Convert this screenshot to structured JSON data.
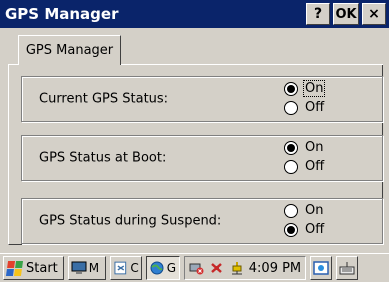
{
  "window": {
    "title": "GPS Manager",
    "help_label": "?",
    "ok_label": "OK",
    "close_label": "×"
  },
  "tab": {
    "label": "GPS Manager"
  },
  "groups": [
    {
      "label": "Current GPS Status:",
      "on_label": "On",
      "off_label": "Off",
      "selected": "On"
    },
    {
      "label": "GPS Status at Boot:",
      "on_label": "On",
      "off_label": "Off",
      "selected": "On"
    },
    {
      "label": "GPS Status during Suspend:",
      "on_label": "On",
      "off_label": "Off",
      "selected": "Off"
    }
  ],
  "taskbar": {
    "start_label": "Start",
    "tasks": [
      {
        "label": "M",
        "icon": "monitor-icon"
      },
      {
        "label": "C",
        "icon": "document-icon"
      },
      {
        "label": "G",
        "icon": "globe-icon"
      }
    ],
    "tray": {
      "time": "4:09 PM"
    }
  }
}
